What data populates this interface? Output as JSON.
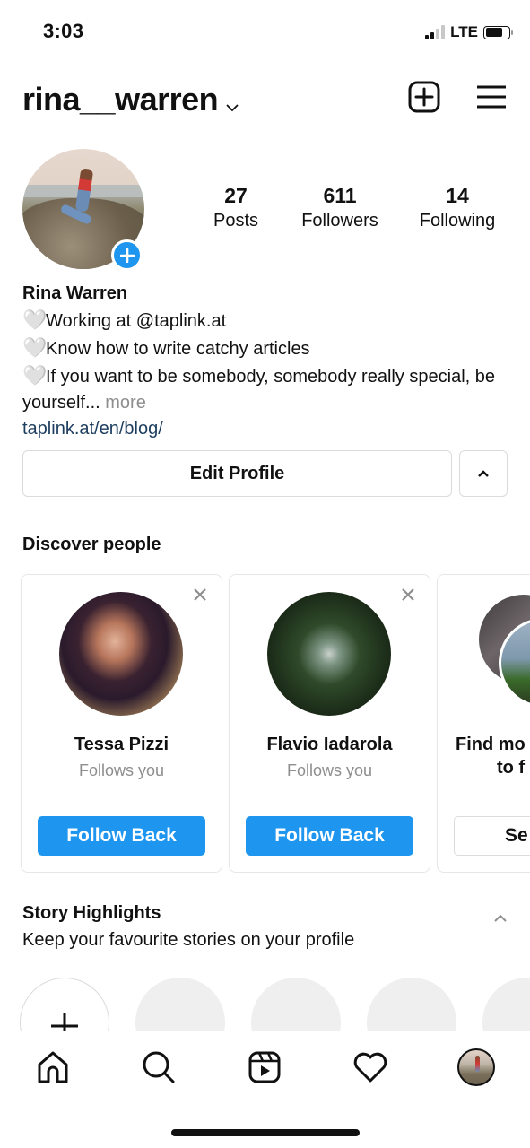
{
  "status_bar": {
    "time": "3:03",
    "network": "LTE",
    "signal_bars_on": 2,
    "signal_bars_total": 4,
    "battery_level": 0.75
  },
  "header": {
    "username": "rina__warren",
    "username_dropdown_icon": "chevron-down-icon",
    "new_post_icon": "plus-square-icon",
    "menu_icon": "hamburger-menu-icon"
  },
  "profile": {
    "avatar_icon": "profile-photo",
    "add_story_icon": "plus-circle-icon",
    "stats": [
      {
        "value": "27",
        "label": "Posts"
      },
      {
        "value": "611",
        "label": "Followers"
      },
      {
        "value": "14",
        "label": "Following"
      }
    ],
    "display_name": "Rina Warren",
    "bio_lines": [
      {
        "emoji": "🤍",
        "text": "Working at @taplink.at"
      },
      {
        "emoji": "🤍",
        "text": "Know how to write catchy articles"
      },
      {
        "emoji": "🤍",
        "text": "If you want to be somebody, somebody really special, be yourself..."
      }
    ],
    "more_label": "more",
    "link": "taplink.at/en/blog/",
    "edit_profile_label": "Edit Profile",
    "suggestions_toggle_icon": "chevron-up-icon"
  },
  "discover": {
    "title": "Discover people",
    "cards": [
      {
        "name": "Tessa Pizzi",
        "subtitle": "Follows you",
        "button": "Follow Back",
        "dismissible": true
      },
      {
        "name": "Flavio Iadarola",
        "subtitle": "Follows you",
        "button": "Follow Back",
        "dismissible": true
      },
      {
        "name_line1": "Find mo",
        "name_line2": "to f",
        "button": "Se"
      }
    ],
    "accent_color": "#1E96F0"
  },
  "highlights": {
    "title": "Story Highlights",
    "subtitle": "Keep your favourite stories on your profile",
    "collapse_icon": "chevron-up-icon",
    "new_icon": "plus-icon",
    "placeholder_count": 4
  },
  "tab_bar": {
    "tabs": [
      {
        "name": "home",
        "icon": "home-icon"
      },
      {
        "name": "search",
        "icon": "search-icon"
      },
      {
        "name": "reels",
        "icon": "reels-icon"
      },
      {
        "name": "activity",
        "icon": "heart-icon"
      },
      {
        "name": "profile",
        "icon": "profile-avatar"
      }
    ]
  }
}
